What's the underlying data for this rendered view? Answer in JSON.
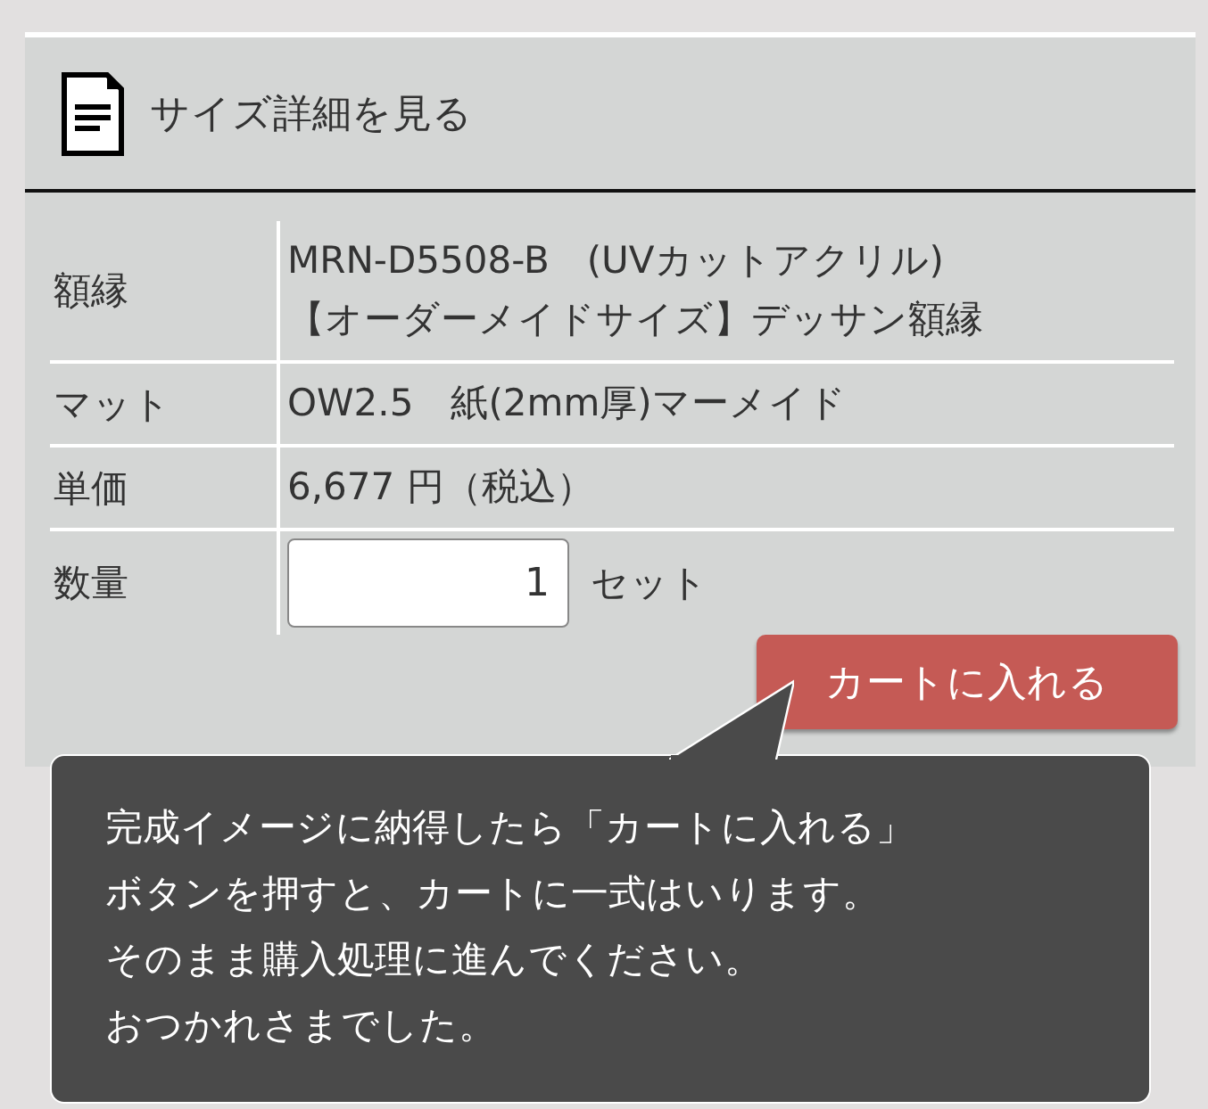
{
  "header": {
    "title": "サイズ詳細を見る"
  },
  "details": {
    "rows": [
      {
        "kind": "text",
        "label": "額縁",
        "lines": [
          "MRN-D5508-B　(UVカットアクリル)",
          "【オーダーメイドサイズ】デッサン額縁"
        ]
      },
      {
        "kind": "text",
        "label": "マット",
        "lines": [
          "OW2.5　紙(2mm厚)マーメイド"
        ]
      },
      {
        "kind": "text",
        "label": "単価",
        "lines": [
          "6,677 円（税込）"
        ]
      },
      {
        "kind": "quantity",
        "label": "数量",
        "value": "1",
        "unit": "セット"
      }
    ]
  },
  "cart_button": {
    "label": "カートに入れる"
  },
  "tooltip": {
    "lines": [
      "完成イメージに納得したら「カートに入れる」",
      "ボタンを押すと、カートに一式はいります。",
      "そのまま購入処理に進んでください。",
      "おつかれさまでした。"
    ]
  }
}
